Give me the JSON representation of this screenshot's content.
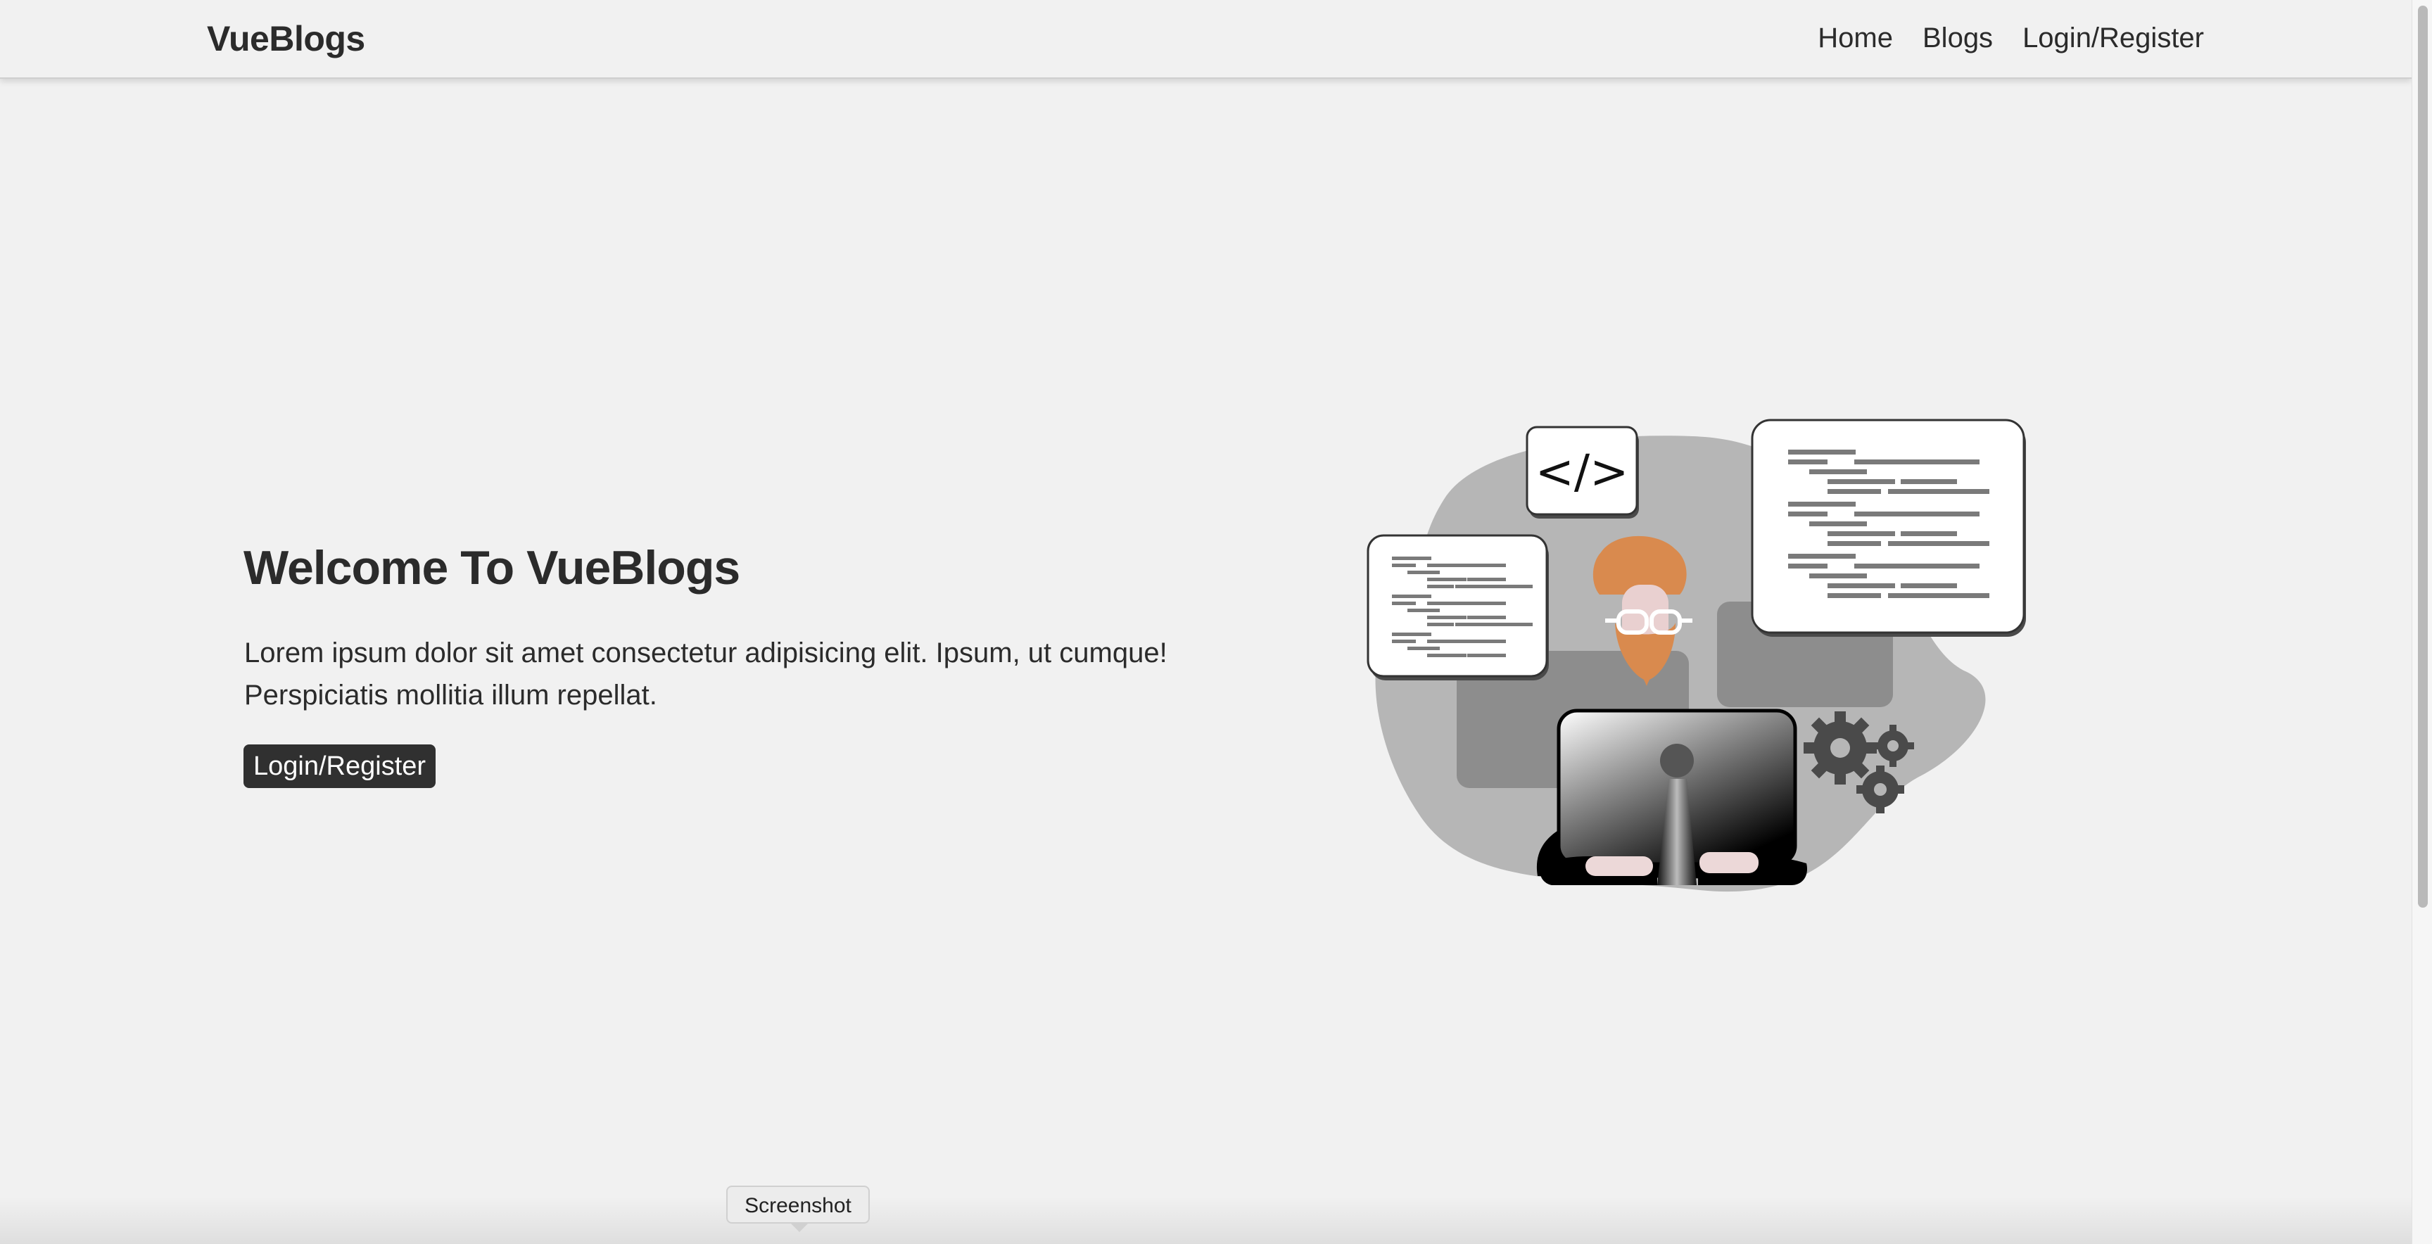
{
  "navbar": {
    "brand": "VueBlogs",
    "links": [
      {
        "label": "Home"
      },
      {
        "label": "Blogs"
      },
      {
        "label": "Login/Register"
      }
    ]
  },
  "hero": {
    "title": "Welcome To VueBlogs",
    "text": "Lorem ipsum dolor sit amet consectetur adipisicing elit. Ipsum, ut cumque! Perspiciatis mollitia illum repellat.",
    "button_label": "Login/Register"
  },
  "illustration": {
    "code_tag": "</>",
    "icon": "developer-at-computer-illustration"
  },
  "tooltip": {
    "label": "Screenshot"
  }
}
